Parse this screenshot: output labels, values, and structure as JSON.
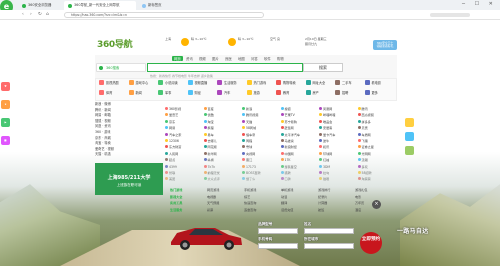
{
  "browser": {
    "tabs": [
      {
        "label": "360安全浏览器",
        "active": false
      },
      {
        "label": "360导航_新一代安全上网导航",
        "active": true
      },
      {
        "label": "新标签页",
        "active": false
      }
    ],
    "url": "https://hao.360.com/?src=lm&ls=n",
    "nav_back": "‹",
    "nav_forward": "›",
    "nav_refresh": "↻",
    "nav_home": "⌂"
  },
  "header": {
    "brand": "360",
    "brand_suffix": "导航",
    "city": "上海",
    "weather_today": "晴 3~10℃",
    "weather_tomorrow": "晴 3~10℃",
    "air": "空气 良",
    "date": "2月10日 星期三",
    "lunar": "腊月廿九",
    "promo_line1": "360安全卫士",
    "promo_line2": "领取新春好礼"
  },
  "search": {
    "tabs": [
      "网页",
      "资讯",
      "视频",
      "图片",
      "良医",
      "地图",
      "问答",
      "软件",
      "购物"
    ],
    "placeholder": "360搜索",
    "button": "搜索",
    "hotwords": "热搜：新春快乐  春节档电影  牛年吉祥  返乡政策"
  },
  "categories": [
    [
      "影视热剧",
      "游戏中心",
      "小说阅读",
      "视频直播",
      "生活服务",
      "热门游戏",
      "购物特卖",
      "网址大全",
      "二手车",
      "看电影"
    ],
    [
      "体育",
      "新闻",
      "军事",
      "财经",
      "汽车",
      "旅游",
      "教育",
      "房产",
      "招聘",
      "更多"
    ]
  ],
  "left_panel": [
    "新浪 · 微博",
    "腾讯 · 新闻",
    "网易 · 邮箱",
    "搜狐 · 视频",
    "凤凰 · 资讯",
    "360 · 游戏",
    "京东 · 商城",
    "淘宝 · 特卖",
    "爱奇艺 · 视频",
    "天猫 · 精选"
  ],
  "grid": [
    [
      "360影视",
      "百度",
      "新浪",
      "搜狐",
      "凤凰网",
      "腾讯"
    ],
    [
      "爱奇艺",
      "优酷",
      "腾讯视频",
      "芒果TV",
      "哔哩哔哩",
      "西瓜视频"
    ],
    [
      "京东",
      "淘宝",
      "天猫",
      "苏宁易购",
      "唯品会",
      "拼多多"
    ],
    [
      "网易",
      "携程",
      "58同城",
      "赶集网",
      "安居客",
      "贝壳"
    ],
    [
      "汽车之家",
      "易车",
      "懂车帝",
      "太平洋汽车",
      "爱卡汽车",
      "车质网"
    ],
    [
      "12306",
      "去哪儿",
      "同程",
      "马蜂窝",
      "途牛",
      "飞猪"
    ],
    [
      "东方财富",
      "同花顺",
      "雪球",
      "新浪财经",
      "和讯",
      "证券之星"
    ],
    [
      "人民网",
      "新华网",
      "央视网",
      "中国网",
      "环球网",
      "光明网"
    ],
    [
      "起点",
      "纵横",
      "晋江",
      "17K",
      "红袖",
      "潇湘"
    ],
    [
      "4399",
      "7k7k",
      "17173",
      "游民星空",
      "3DM",
      "多玩"
    ],
    [
      "智联",
      "前程无忧",
      "BOSS直聘",
      "猎聘",
      "拉勾",
      "58招聘"
    ],
    [
      "美团",
      "大众点评",
      "饿了么",
      "口碑",
      "猫眼",
      "淘票票"
    ]
  ],
  "ad_banner": {
    "title": "上海985/211大学",
    "subtitle": "上班族在职可读"
  },
  "bottom_table": [
    [
      "热门游戏",
      "网页游戏",
      "手机游戏",
      "单机游戏",
      "游戏排行",
      "游戏礼包"
    ],
    [
      "影视大全",
      "电视剧",
      "综艺",
      "动漫",
      "纪录片",
      "电影"
    ],
    [
      "实用工具",
      "天气预报",
      "快递查询",
      "翻译",
      "计算器",
      "万年历"
    ],
    [
      "生活服务",
      "彩票",
      "违章查询",
      "话费充值",
      "航班",
      "酒店"
    ]
  ],
  "car_ad": {
    "form_label_1": "品牌型号",
    "form_label_2": "姓名",
    "form_label_3": "手机号码",
    "form_label_4": "所在城市",
    "cta": "立即预约",
    "tagline": "一路马自达",
    "close": "×"
  },
  "colors": {
    "brand_green": "#2cb44a",
    "cta_red": "#c8161d"
  }
}
